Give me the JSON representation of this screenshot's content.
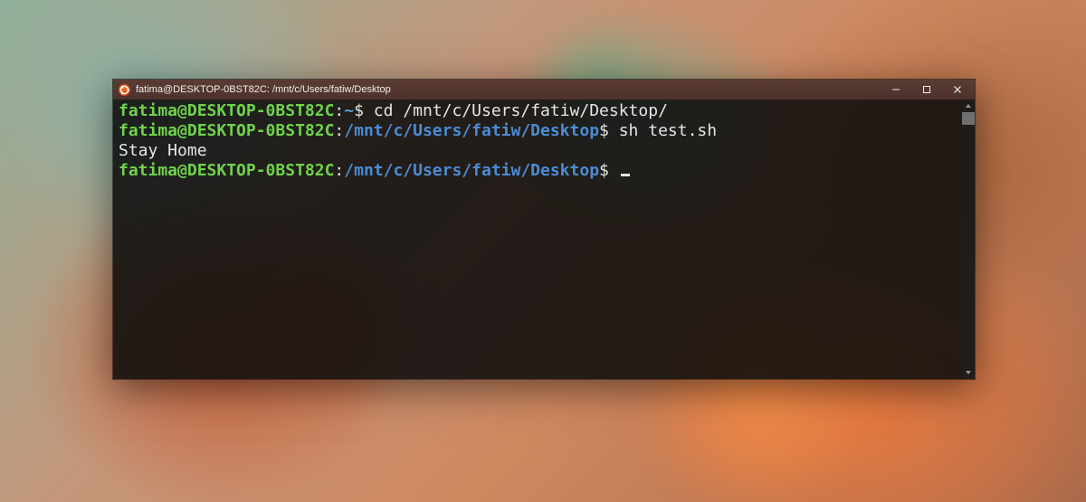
{
  "window": {
    "title": "fatima@DESKTOP-0BST82C: /mnt/c/Users/fatiw/Desktop"
  },
  "colors": {
    "prompt_user": "#6fd34a",
    "prompt_path": "#4a8cd6",
    "text": "#e6e6e6",
    "titlebar_bg": "#4d322b",
    "terminal_bg": "rgba(12,12,12,0.88)"
  },
  "lines": {
    "l1": {
      "user_host": "fatima@DESKTOP-0BST82C",
      "sep": ":",
      "path": "~",
      "dollar": "$ ",
      "command": "cd /mnt/c/Users/fatiw/Desktop/"
    },
    "l2": {
      "user_host": "fatima@DESKTOP-0BST82C",
      "sep": ":",
      "path": "/mnt/c/Users/fatiw/Desktop",
      "dollar": "$ ",
      "command": "sh test.sh"
    },
    "l3": {
      "output": "Stay Home"
    },
    "l4": {
      "user_host": "fatima@DESKTOP-0BST82C",
      "sep": ":",
      "path": "/mnt/c/Users/fatiw/Desktop",
      "dollar": "$ "
    }
  }
}
